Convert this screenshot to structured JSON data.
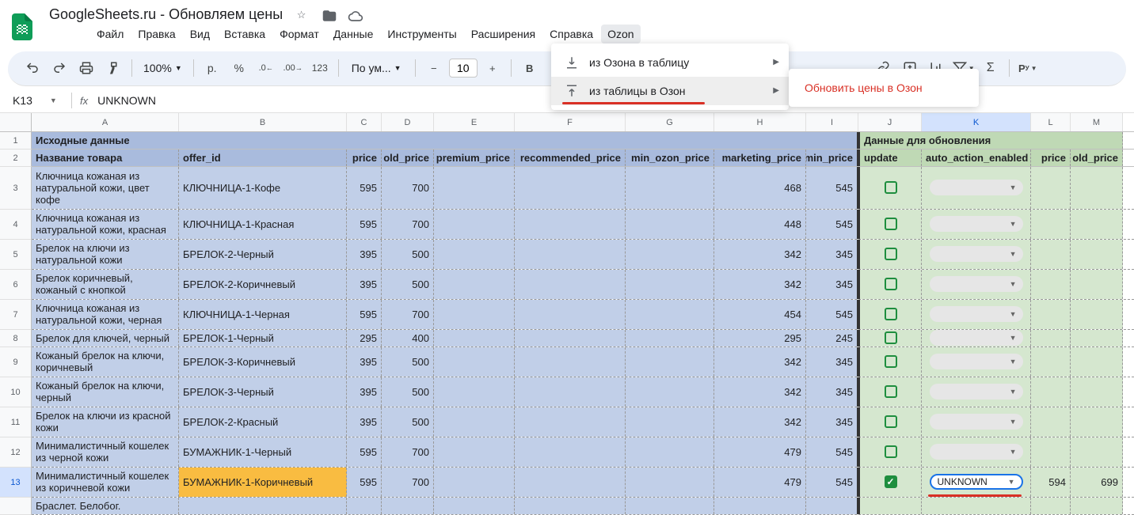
{
  "doc": {
    "title": "GoogleSheets.ru - Обновляем цены"
  },
  "menu": {
    "items": [
      "Файл",
      "Правка",
      "Вид",
      "Вставка",
      "Формат",
      "Данные",
      "Инструменты",
      "Расширения",
      "Справка",
      "Ozon"
    ]
  },
  "dropdown": {
    "item1": "из Озона в таблицу",
    "item2": "из таблицы в Озон",
    "submenu1": "Обновить цены в Озон"
  },
  "toolbar": {
    "zoom": "100%",
    "currency": "р.",
    "percent": "%",
    "font": "По ум...",
    "size": "10"
  },
  "formula": {
    "cell": "K13",
    "fx": "fx",
    "value": "UNKNOWN"
  },
  "cols": [
    "A",
    "B",
    "C",
    "D",
    "E",
    "F",
    "G",
    "H",
    "I",
    "J",
    "K",
    "L",
    "M"
  ],
  "rows": [
    "1",
    "2",
    "3",
    "4",
    "5",
    "6",
    "7",
    "8",
    "9",
    "10",
    "11",
    "12",
    "13",
    ""
  ],
  "headers": {
    "sec1": "Исходные данные",
    "sec2": "Данные для обновления",
    "c": [
      "Название товара",
      "offer_id",
      "price",
      "old_price",
      "premium_price",
      "recommended_price",
      "min_ozon_price",
      "marketing_price",
      "min_price",
      "update",
      "auto_action_enabled",
      "price",
      "old_price"
    ]
  },
  "data": [
    {
      "name": "Ключница кожаная из натуральной кожи, цвет кофе",
      "offer": "КЛЮЧНИЦА-1-Кофе",
      "price": "595",
      "old": "700",
      "mkt": "468",
      "min": "545"
    },
    {
      "name": "Ключница кожаная из натуральной кожи, красная",
      "offer": "КЛЮЧНИЦА-1-Красная",
      "price": "595",
      "old": "700",
      "mkt": "448",
      "min": "545"
    },
    {
      "name": "Брелок на ключи из натуральной кожи",
      "offer": "БРЕЛОК-2-Черный",
      "price": "395",
      "old": "500",
      "mkt": "342",
      "min": "345"
    },
    {
      "name": "Брелок коричневый, кожаный с кнопкой",
      "offer": "БРЕЛОК-2-Коричневый",
      "price": "395",
      "old": "500",
      "mkt": "342",
      "min": "345"
    },
    {
      "name": "Ключница кожаная из натуральной кожи, черная",
      "offer": "КЛЮЧНИЦА-1-Черная",
      "price": "595",
      "old": "700",
      "mkt": "454",
      "min": "545"
    },
    {
      "name": "Брелок для ключей, черный",
      "offer": "БРЕЛОК-1-Черный",
      "price": "295",
      "old": "400",
      "mkt": "295",
      "min": "245"
    },
    {
      "name": "Кожаный брелок на ключи, коричневый",
      "offer": "БРЕЛОК-3-Коричневый",
      "price": "395",
      "old": "500",
      "mkt": "342",
      "min": "345"
    },
    {
      "name": "Кожаный брелок на ключи, черный",
      "offer": "БРЕЛОК-3-Черный",
      "price": "395",
      "old": "500",
      "mkt": "342",
      "min": "345"
    },
    {
      "name": "Брелок на ключи из красной кожи",
      "offer": "БРЕЛОК-2-Красный",
      "price": "395",
      "old": "500",
      "mkt": "342",
      "min": "345"
    },
    {
      "name": "Минималистичный кошелек из черной кожи",
      "offer": "БУМАЖНИК-1-Черный",
      "price": "595",
      "old": "700",
      "mkt": "479",
      "min": "545"
    },
    {
      "name": "Минималистичный кошелек из коричневой кожи",
      "offer": "БУМАЖНИК-1-Коричневый",
      "price": "595",
      "old": "700",
      "mkt": "479",
      "min": "545",
      "checked": true,
      "auto": "UNKNOWN",
      "uprice": "594",
      "uold": "699"
    },
    {
      "name": "Браслет. Белобог.",
      "offer": "",
      "price": "",
      "old": "",
      "mkt": "",
      "min": ""
    }
  ]
}
